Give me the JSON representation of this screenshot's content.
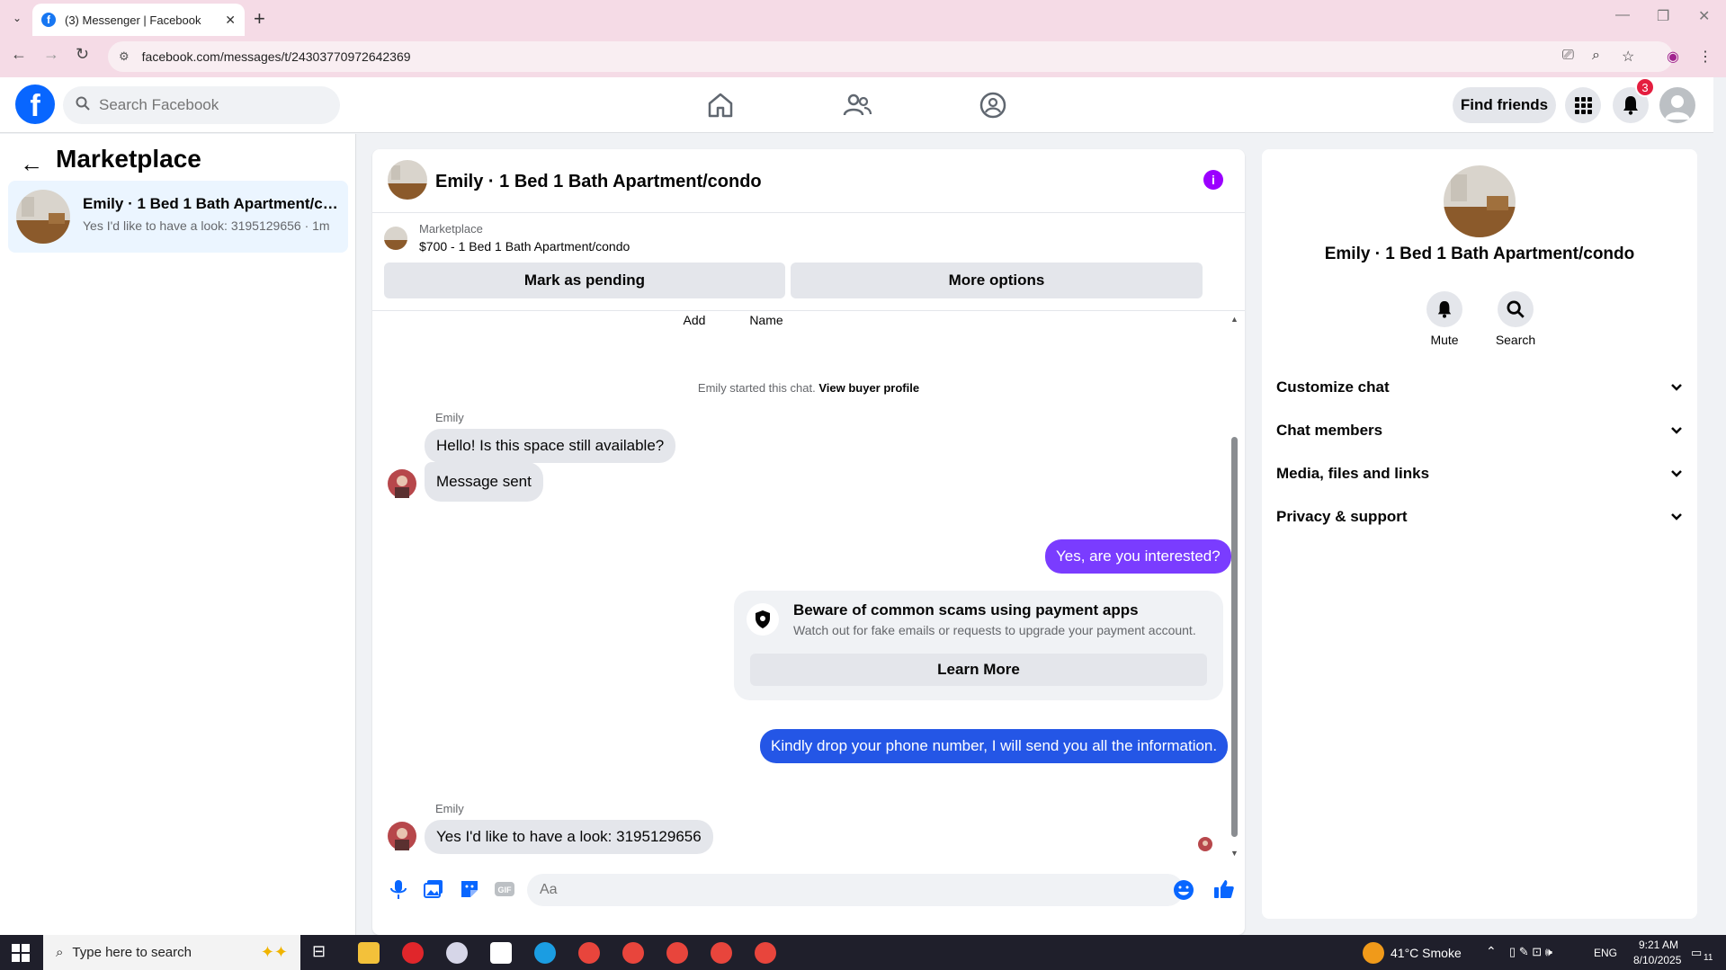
{
  "browser": {
    "tab_title": "(3) Messenger | Facebook",
    "url": "facebook.com/messages/t/24303770972642369"
  },
  "header": {
    "search_placeholder": "Search Facebook",
    "find_friends": "Find friends",
    "notif_count": "3"
  },
  "left": {
    "title": "Marketplace",
    "conversation": {
      "name": "Emily · 1 Bed 1 Bath Apartment/condo",
      "preview": "Yes I'd like to have a look: 3195129656 · 1m"
    }
  },
  "chat": {
    "title": "Emily · 1 Bed 1 Bath Apartment/condo",
    "marketplace_label": "Marketplace",
    "listing": "$700 - 1 Bed 1 Bath Apartment/condo",
    "mark_pending": "Mark as pending",
    "more_options": "More options",
    "actions": {
      "add": "Add",
      "name": "Name"
    },
    "started_text": "Emily started this chat.",
    "view_profile": "View buyer profile",
    "messages": [
      {
        "sender": "Emily",
        "text": "Hello! Is this space still available?"
      },
      {
        "text": "Message sent"
      },
      {
        "text": "Yes, are you interested?"
      },
      {
        "text": "Kindly drop your phone number, I will send you all the information."
      },
      {
        "sender": "Emily",
        "text": "Yes I'd like to have a look: 3195129656"
      }
    ],
    "scam": {
      "title": "Beware of common scams using payment apps",
      "subtitle": "Watch out for fake emails or requests to upgrade your payment account.",
      "button": "Learn More"
    },
    "composer_placeholder": "Aa"
  },
  "right": {
    "name": "Emily · 1 Bed 1 Bath Apartment/condo",
    "mute": "Mute",
    "search": "Search",
    "sections": [
      "Customize chat",
      "Chat members",
      "Media, files and links",
      "Privacy & support"
    ]
  },
  "taskbar": {
    "search_placeholder": "Type here to search",
    "weather": "41°C Smoke",
    "lang": "ENG",
    "time": "9:21 AM",
    "date": "8/10/2025",
    "notif": "11"
  },
  "colors": {
    "fb_blue": "#0866ff",
    "bubble_purple": "#7a3cff",
    "bubble_blue": "#2456e6"
  }
}
